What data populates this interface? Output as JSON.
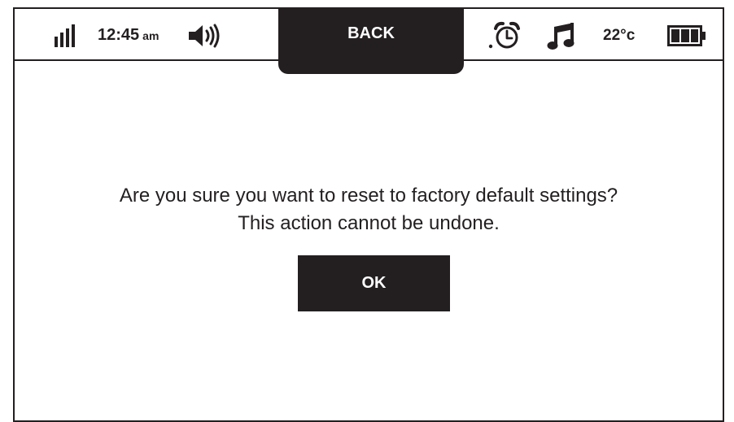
{
  "status_bar": {
    "time": "12:45",
    "ampm": "am",
    "temperature": "22°c",
    "icons": [
      "signal-icon",
      "volume-icon",
      "alarm-icon",
      "music-icon",
      "battery-icon"
    ]
  },
  "back_button": {
    "label": "BACK"
  },
  "dialog": {
    "line1": "Are you sure you want to reset to factory default settings?",
    "line2": "This action cannot be undone.",
    "ok_label": "OK"
  },
  "colors": {
    "foreground": "#231f20",
    "background": "#ffffff"
  }
}
